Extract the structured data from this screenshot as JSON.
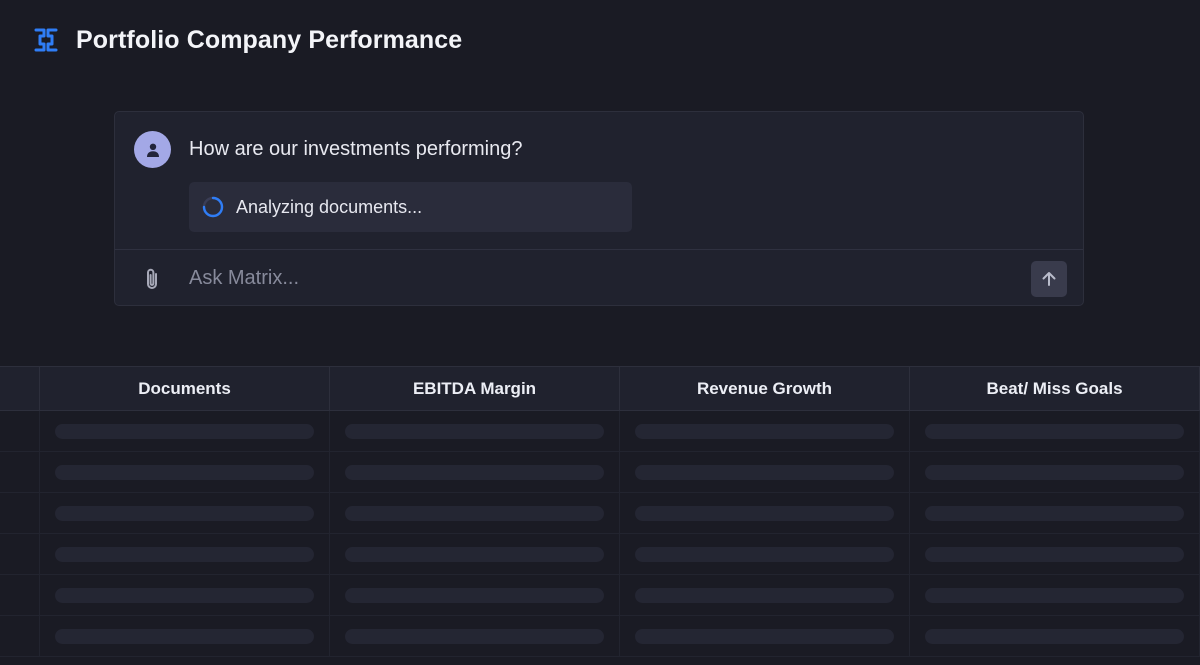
{
  "header": {
    "title": "Portfolio Company Performance",
    "logo_icon": "matrix-logo-icon",
    "accent_color": "#2f7df6"
  },
  "chat": {
    "user_message": "How are our investments performing?",
    "status_text": "Analyzing documents...",
    "input": {
      "value": "",
      "placeholder": "Ask Matrix..."
    },
    "attach_icon": "paperclip-icon",
    "send_icon": "arrow-up-icon",
    "avatar_icon": "user-icon"
  },
  "table": {
    "columns": [
      "Documents",
      "EBITDA Margin",
      "Revenue Growth",
      "Beat/ Miss Goals"
    ],
    "rows_loading": 6,
    "state": "loading"
  }
}
